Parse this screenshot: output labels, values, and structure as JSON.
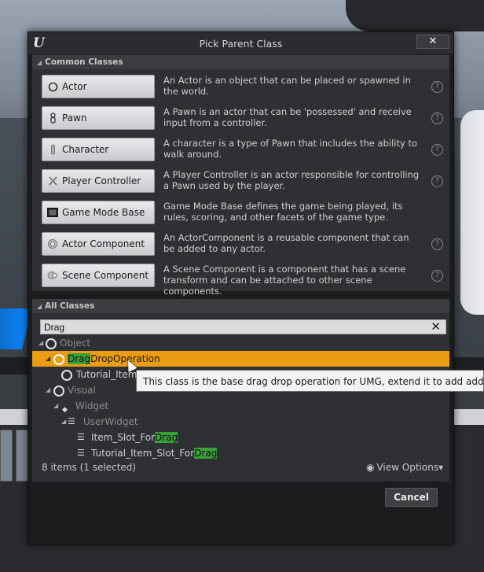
{
  "dialog": {
    "title": "Pick Parent Class",
    "close_label": "✕",
    "logo": "U"
  },
  "common_classes": {
    "header": "Common Classes",
    "items": [
      {
        "label": "Actor",
        "icon": "actor-icon",
        "desc": "An Actor is an object that can be placed or spawned in the world."
      },
      {
        "label": "Pawn",
        "icon": "pawn-icon",
        "desc": "A Pawn is an actor that can be 'possessed' and receive input from a controller."
      },
      {
        "label": "Character",
        "icon": "character-icon",
        "desc": "A character is a type of Pawn that includes the ability to walk around."
      },
      {
        "label": "Player Controller",
        "icon": "player-controller-icon",
        "desc": "A Player Controller is an actor responsible for controlling a Pawn used by the player."
      },
      {
        "label": "Game Mode Base",
        "icon": "game-mode-icon",
        "desc": "Game Mode Base defines the game being played, its rules, scoring, and other facets of the game type."
      },
      {
        "label": "Actor Component",
        "icon": "actor-component-icon",
        "desc": "An ActorComponent is a reusable component that can be added to any actor."
      },
      {
        "label": "Scene Component",
        "icon": "scene-component-icon",
        "desc": "A Scene Component is a component that has a scene transform and can be attached to other scene components."
      }
    ],
    "help_glyph": "?"
  },
  "all_classes": {
    "header": "All Classes",
    "search_value": "Drag",
    "clear_label": "✕",
    "tree": {
      "object": "Object",
      "dragdrop_match": "Drag",
      "dragdrop_rest": "DropOperation",
      "tutorial_item": "Tutorial_Item_",
      "visual": "Visual",
      "widget": "Widget",
      "userwidget": "UserWidget",
      "item_slot_prefix": "Item_Slot_For",
      "item_slot_match": "Drag",
      "tutorial_slot_prefix": "Tutorial_Item_Slot_For",
      "tutorial_slot_match": "Drag"
    },
    "item_count": "8 items (1 selected)",
    "view_options": "View Options",
    "view_options_caret": "▾",
    "tooltip": "This class is the base drag drop operation for UMG, extend it to add additional da"
  },
  "buttons": {
    "cancel": "Cancel"
  },
  "colors": {
    "selection": "#ea9c12",
    "search_highlight": "#39a13a",
    "dialog_bg": "#1b1c1e",
    "panel_bg": "#2f3033"
  }
}
